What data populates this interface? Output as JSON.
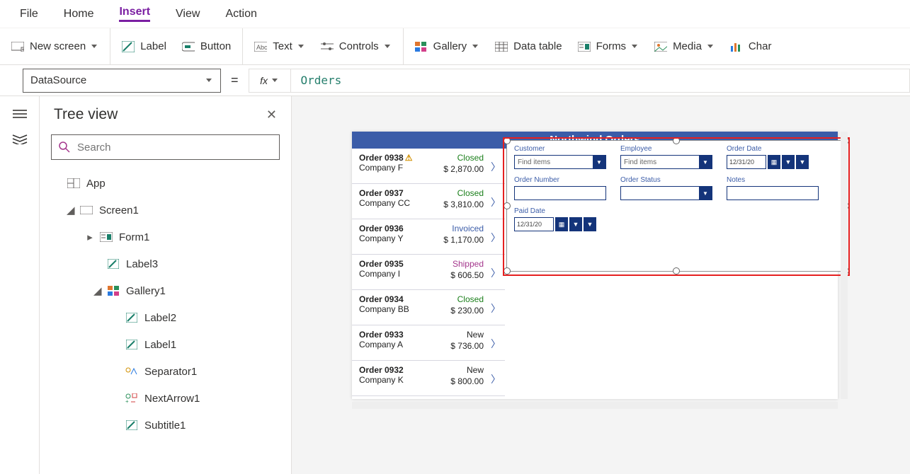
{
  "menu": {
    "file": "File",
    "home": "Home",
    "insert": "Insert",
    "view": "View",
    "action": "Action",
    "active": "insert"
  },
  "ribbon": {
    "new_screen": "New screen",
    "label": "Label",
    "button": "Button",
    "text": "Text",
    "controls": "Controls",
    "gallery": "Gallery",
    "datatable": "Data table",
    "forms": "Forms",
    "media": "Media",
    "chart": "Char"
  },
  "formula": {
    "property": "DataSource",
    "value": "Orders"
  },
  "panel": {
    "title": "Tree view",
    "search_placeholder": "Search"
  },
  "tree": {
    "app": "App",
    "screen": "Screen1",
    "form": "Form1",
    "label3": "Label3",
    "gallery": "Gallery1",
    "label2": "Label2",
    "label1": "Label1",
    "separator": "Separator1",
    "nextarrow": "NextArrow1",
    "subtitle": "Subtitle1"
  },
  "app": {
    "title": "Northwind Orders",
    "orders": [
      {
        "num": "Order 0938",
        "warn": true,
        "company": "Company F",
        "status": "Closed",
        "status_cls": "closed",
        "amount": "$ 2,870.00"
      },
      {
        "num": "Order 0937",
        "company": "Company CC",
        "status": "Closed",
        "status_cls": "closed",
        "amount": "$ 3,810.00"
      },
      {
        "num": "Order 0936",
        "company": "Company Y",
        "status": "Invoiced",
        "status_cls": "invoiced",
        "amount": "$ 1,170.00"
      },
      {
        "num": "Order 0935",
        "company": "Company I",
        "status": "Shipped",
        "status_cls": "shipped",
        "amount": "$ 606.50"
      },
      {
        "num": "Order 0934",
        "company": "Company BB",
        "status": "Closed",
        "status_cls": "closed",
        "amount": "$ 230.00"
      },
      {
        "num": "Order 0933",
        "company": "Company A",
        "status": "New",
        "status_cls": "new",
        "amount": "$ 736.00"
      },
      {
        "num": "Order 0932",
        "company": "Company K",
        "status": "New",
        "status_cls": "new",
        "amount": "$ 800.00"
      }
    ],
    "form": {
      "customer": "Customer",
      "employee": "Employee",
      "orderdate": "Order Date",
      "ordernum": "Order Number",
      "orderstatus": "Order Status",
      "notes": "Notes",
      "paiddate": "Paid Date",
      "find": "Find items",
      "date": "12/31/20"
    }
  }
}
